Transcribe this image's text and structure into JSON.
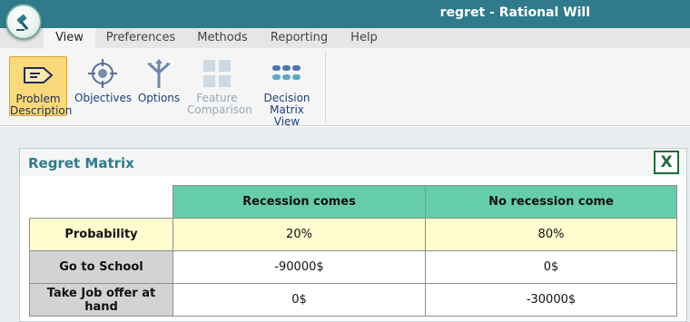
{
  "window": {
    "title": "regret - Rational Will"
  },
  "menu_tabs": [
    "View",
    "Preferences",
    "Methods",
    "Reporting",
    "Help"
  ],
  "ribbon": {
    "problem_description": {
      "line1": "Problem",
      "line2": "Description"
    },
    "objectives": "Objectives",
    "options": "Options",
    "feature_comparison": {
      "line1": "Feature",
      "line2": "Comparison"
    },
    "decision_matrix_view": {
      "line1": "Decision",
      "line2": "Matrix View"
    }
  },
  "panel": {
    "title": "Regret Matrix",
    "excel_label": "X"
  },
  "matrix": {
    "columns": [
      "Recession comes",
      "No recession come"
    ],
    "probability": {
      "label": "Probability",
      "values": [
        "20%",
        "80%"
      ]
    },
    "rows": [
      {
        "label": "Go to School",
        "values": [
          "-90000$",
          "0$"
        ]
      },
      {
        "label": "Take Job offer at hand",
        "values": [
          "0$",
          "-30000$"
        ]
      }
    ]
  },
  "colors": {
    "titlebar": "#2f7b8c",
    "header_accent": "#66cdaa",
    "probability_row": "#fffdd0",
    "row_header": "#d3d3d3"
  }
}
